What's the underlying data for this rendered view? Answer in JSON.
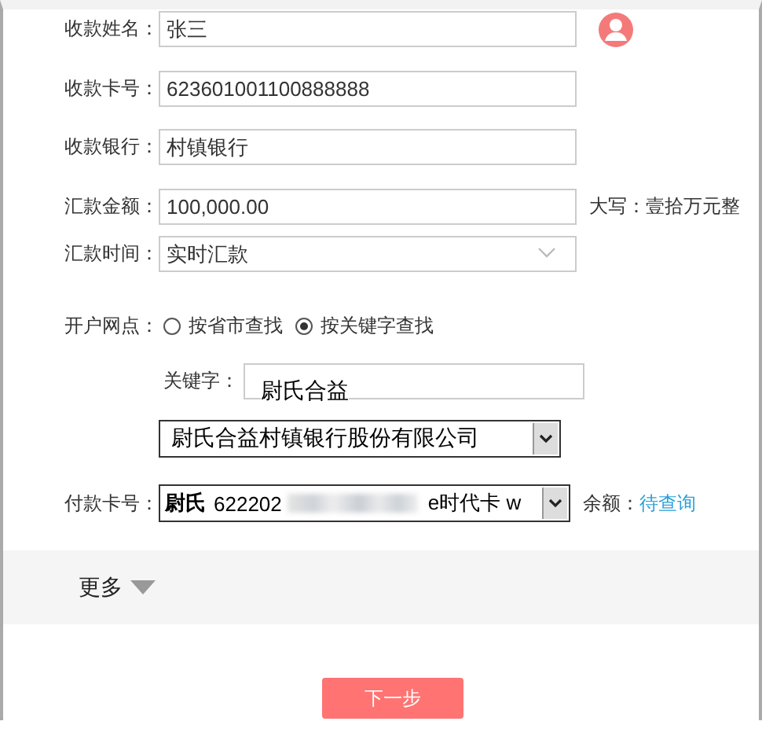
{
  "fields": [
    {
      "label": "收款姓名：",
      "value": "张三",
      "kind": "text",
      "contact_icon": true
    },
    {
      "label": "收款卡号：",
      "value": "623601001100888888",
      "kind": "text"
    },
    {
      "label": "收款银行：",
      "value": "村镇银行",
      "kind": "text"
    },
    {
      "label": "汇款金额：",
      "value": "100,000.00",
      "kind": "text",
      "note": "大写：壹拾万元整"
    },
    {
      "label": "汇款时间：",
      "value": "实时汇款",
      "kind": "dropdown"
    }
  ],
  "branch": {
    "label": "开户网点：",
    "options": [
      {
        "label": "按省市查找",
        "selected": false
      },
      {
        "label": "按关键字查找",
        "selected": true
      }
    ],
    "keyword_label": "关键字：",
    "keyword_value": "尉氏合益",
    "branch_select": "尉氏合益村镇银行股份有限公司"
  },
  "payment": {
    "label": "付款卡号：",
    "card_name": "尉氏",
    "card_number_start": "622202",
    "card_type": "e时代卡 w",
    "balance_label": "余额：",
    "balance_link": "待查询"
  },
  "more": "更多",
  "next_button": "下一步"
}
